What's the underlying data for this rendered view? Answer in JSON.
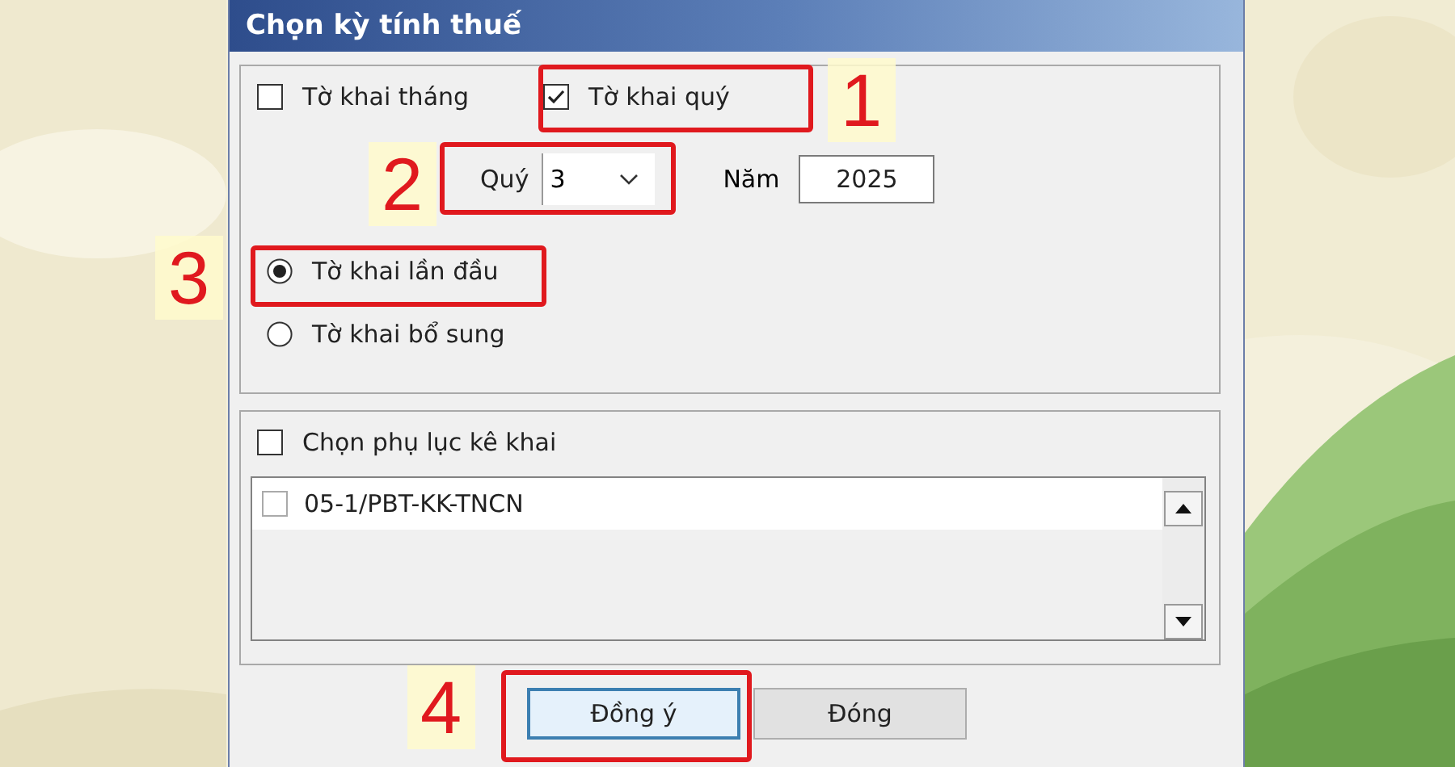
{
  "window": {
    "title": "Chọn kỳ tính thuế"
  },
  "declaration_types": [
    {
      "label": "Tờ khai tháng",
      "checked": false
    },
    {
      "label": "Tờ khai quý",
      "checked": true
    }
  ],
  "quarter": {
    "label": "Quý",
    "value": "3"
  },
  "year": {
    "label": "Năm",
    "value": "2025"
  },
  "submission": [
    {
      "label": "Tờ khai lần đầu",
      "selected": true
    },
    {
      "label": "Tờ khai bổ sung",
      "selected": false
    }
  ],
  "appendix": {
    "label": "Chọn phụ lục kê khai",
    "checked": false,
    "items": [
      {
        "label": "05-1/PBT-KK-TNCN",
        "checked": false
      }
    ]
  },
  "buttons": [
    {
      "label": "Đồng ý",
      "focused": true
    },
    {
      "label": "Đóng",
      "focused": false
    }
  ],
  "annotations": [
    {
      "number": "1"
    },
    {
      "number": "2"
    },
    {
      "number": "3"
    },
    {
      "number": "4"
    }
  ]
}
